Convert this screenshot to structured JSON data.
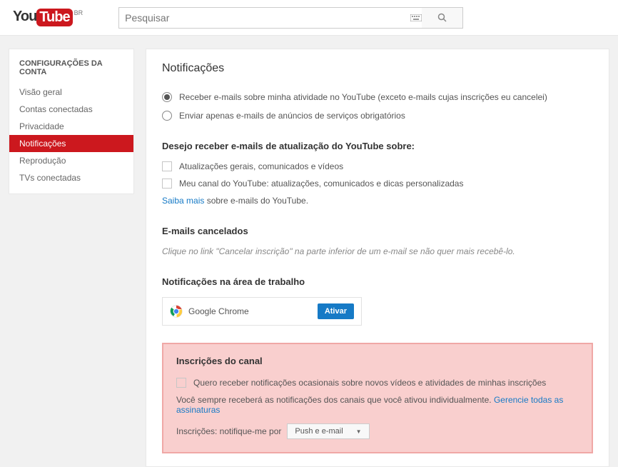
{
  "header": {
    "logo_you": "You",
    "logo_tube": "Tube",
    "logo_region": "BR",
    "search_placeholder": "Pesquisar"
  },
  "sidebar": {
    "title": "CONFIGURAÇÕES DA CONTA",
    "items": [
      {
        "label": "Visão geral"
      },
      {
        "label": "Contas conectadas"
      },
      {
        "label": "Privacidade"
      },
      {
        "label": "Notificações"
      },
      {
        "label": "Reprodução"
      },
      {
        "label": "TVs conectadas"
      }
    ]
  },
  "main": {
    "title": "Notificações",
    "radio1": "Receber e-mails sobre minha atividade no YouTube (exceto e-mails cujas inscrições eu cancelei)",
    "radio2": "Enviar apenas e-mails de anúncios de serviços obrigatórios",
    "updates_title": "Desejo receber e-mails de atualização do YouTube sobre:",
    "check1": "Atualizações gerais, comunicados e vídeos",
    "check2": "Meu canal do YouTube: atualizações, comunicados e dicas personalizadas",
    "learn_more": "Saiba mais",
    "learn_more_suffix": " sobre e-mails do YouTube.",
    "cancelled_title": "E-mails cancelados",
    "cancelled_hint": "Clique no link \"Cancelar inscrição\" na parte inferior de um e-mail se não quer mais recebê-lo.",
    "desktop_title": "Notificações na área de trabalho",
    "chrome_label": "Google Chrome",
    "activate_btn": "Ativar",
    "subs_title": "Inscrições do canal",
    "subs_check": "Quero receber notificações ocasionais sobre novos vídeos e atividades de minhas inscrições",
    "subs_text": "Você sempre receberá as notificações dos canais que você ativou individualmente. ",
    "subs_link": "Gerencie todas as assinaturas",
    "subs_notify_label": "Inscrições: notifique-me por",
    "subs_dropdown": "Push e e-mail"
  }
}
